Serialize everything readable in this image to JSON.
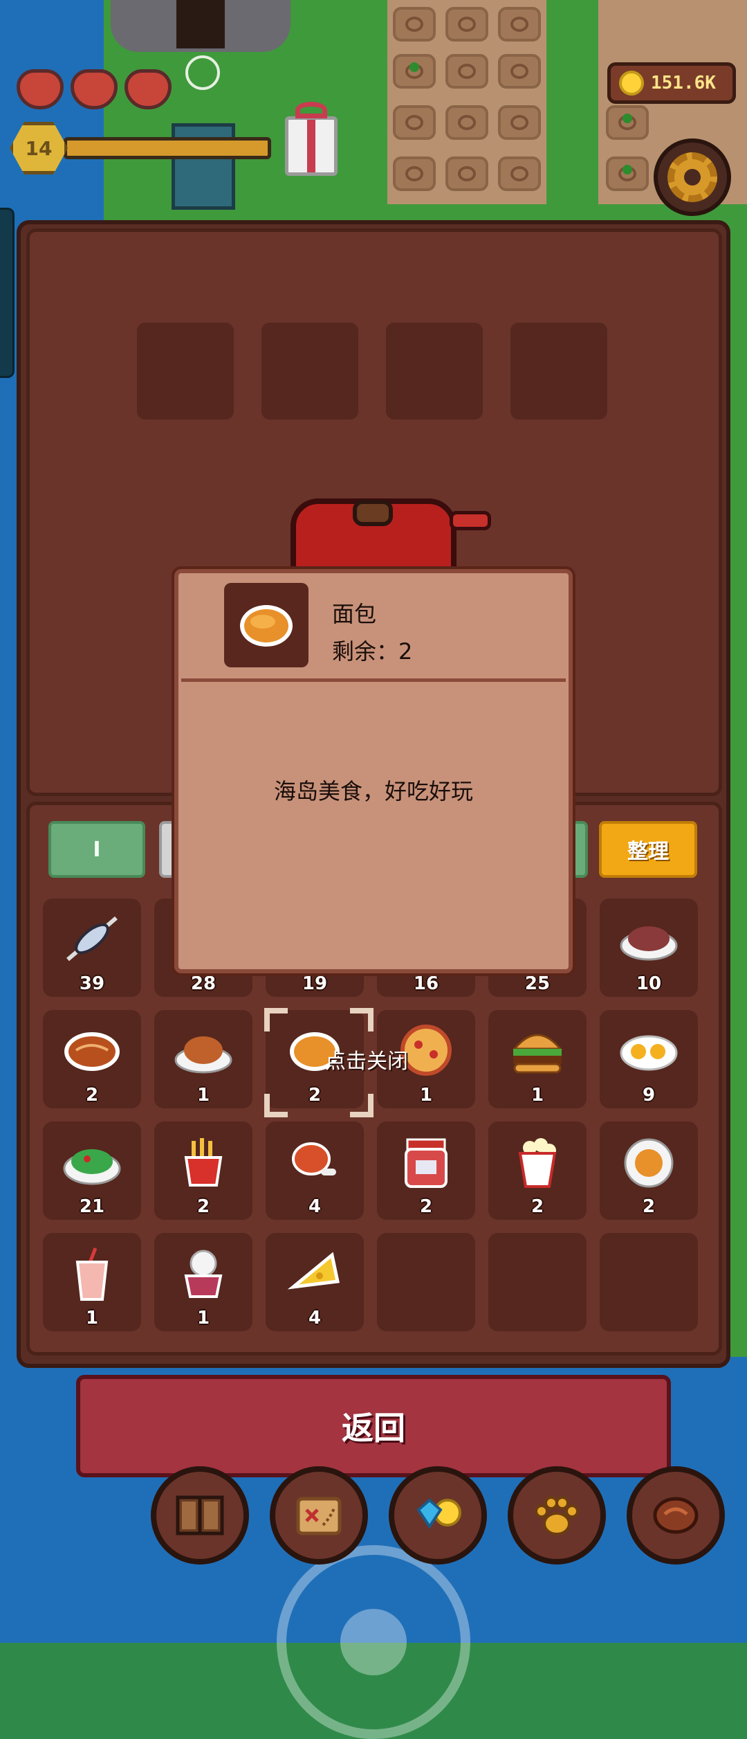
{
  "hud": {
    "hearts": 3,
    "level": "14",
    "coins": "151.6K"
  },
  "tabs": [
    {
      "label": "I",
      "style": "green"
    },
    {
      "label": "",
      "style": "grey"
    },
    {
      "label": "",
      "style": "green"
    },
    {
      "label": "整理",
      "style": "sort"
    }
  ],
  "inventory": [
    {
      "icon": "fish-skewer-icon",
      "count": "39"
    },
    {
      "icon": "food-item-icon",
      "count": "28"
    },
    {
      "icon": "food-item-icon",
      "count": "19"
    },
    {
      "icon": "food-item-icon",
      "count": "16"
    },
    {
      "icon": "food-item-icon",
      "count": "25"
    },
    {
      "icon": "meat-plate-icon",
      "count": "10"
    },
    {
      "icon": "steak-icon",
      "count": "2"
    },
    {
      "icon": "roast-chicken-icon",
      "count": "1"
    },
    {
      "icon": "bread-icon",
      "count": "2"
    },
    {
      "icon": "pizza-icon",
      "count": "1"
    },
    {
      "icon": "burger-icon",
      "count": "1"
    },
    {
      "icon": "fried-eggs-icon",
      "count": "9"
    },
    {
      "icon": "salad-icon",
      "count": "21"
    },
    {
      "icon": "fries-icon",
      "count": "2"
    },
    {
      "icon": "drumstick-icon",
      "count": "4"
    },
    {
      "icon": "jam-jar-icon",
      "count": "2"
    },
    {
      "icon": "popcorn-icon",
      "count": "2"
    },
    {
      "icon": "soup-icon",
      "count": "2"
    },
    {
      "icon": "milkshake-icon",
      "count": "1"
    },
    {
      "icon": "pudding-icon",
      "count": "1"
    },
    {
      "icon": "cheese-icon",
      "count": "4"
    },
    {
      "icon": "",
      "count": ""
    },
    {
      "icon": "",
      "count": ""
    },
    {
      "icon": "",
      "count": ""
    }
  ],
  "popup": {
    "name": "面包",
    "remain": "剩余：2",
    "description": "海岛美食，好吃好玩",
    "close_hint": "点击关闭"
  },
  "return_label": "返回",
  "nav": [
    {
      "icon": "book-icon"
    },
    {
      "icon": "map-scroll-icon"
    },
    {
      "icon": "gems-coins-icon"
    },
    {
      "icon": "paw-icon"
    },
    {
      "icon": "meat-icon"
    }
  ],
  "colors": {
    "panel": "#5a2d24",
    "popup": "#c8927a",
    "return": "#a33440",
    "sort": "#f2a814",
    "coin_text": "#ffe58a"
  }
}
